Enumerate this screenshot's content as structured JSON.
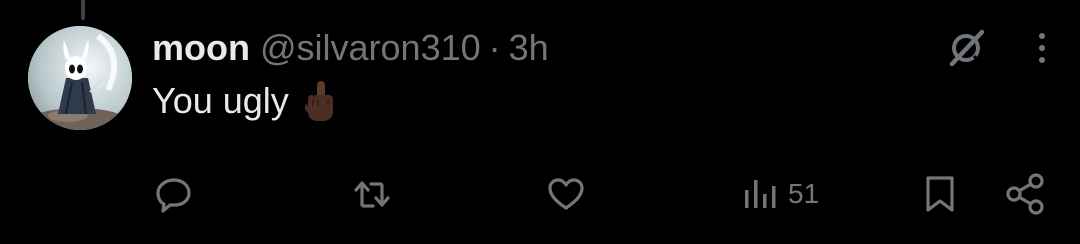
{
  "tweet": {
    "display_name": "moon",
    "handle": "@silvaron310",
    "separator": "·",
    "time": "3h",
    "text": "You ugly",
    "emoji": "middle-finger-dark-skin-tone",
    "avatar": "hollow-knight-avatar"
  },
  "actions": {
    "reply": {
      "icon": "reply-icon"
    },
    "retweet": {
      "icon": "retweet-icon"
    },
    "like": {
      "icon": "heart-icon"
    },
    "views": {
      "icon": "views-chart-icon",
      "count": "51"
    },
    "bookmark": {
      "icon": "bookmark-icon"
    },
    "share": {
      "icon": "share-icon"
    }
  },
  "top_icons": {
    "grok": "grok-icon",
    "more": "more-vertical-icon"
  },
  "colors": {
    "background": "#000000",
    "primary_text": "#e7e9ea",
    "secondary_text": "#71767b",
    "thread_line": "#3e4144"
  }
}
